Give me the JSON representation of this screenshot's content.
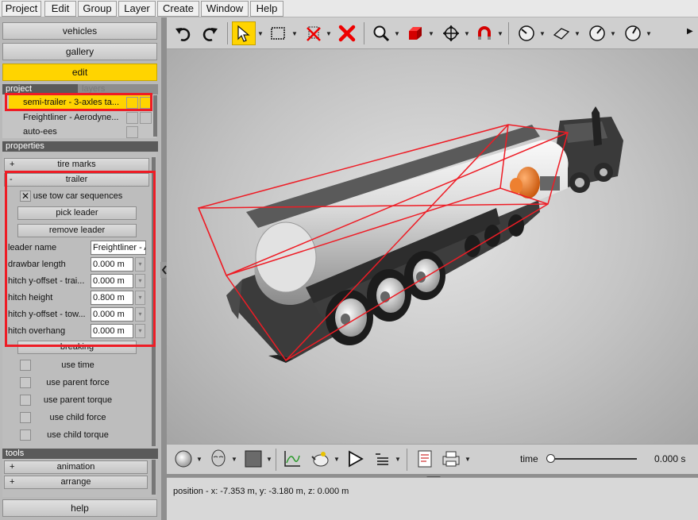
{
  "menubar": {
    "items": [
      {
        "label": "Project"
      },
      {
        "label": "Edit"
      },
      {
        "label": "Group"
      },
      {
        "label": "Layer"
      },
      {
        "label": "Create"
      },
      {
        "label": "Window"
      },
      {
        "label": "Help"
      }
    ]
  },
  "left_panel": {
    "top_buttons": {
      "vehicles": "vehicles",
      "gallery": "gallery",
      "edit": "edit"
    },
    "project_tabs": {
      "project": "project",
      "layers": "layers"
    },
    "project_items": [
      {
        "label": "semi-trailer - 3-axles ta...",
        "selected": true
      },
      {
        "label": "Freightliner - Aerodyne..."
      },
      {
        "label": "auto-ees"
      }
    ],
    "properties_header": "properties",
    "tire_marks": {
      "toggle": "+",
      "label": "tire marks"
    },
    "trailer": {
      "toggle": "-",
      "label": "trailer",
      "use_tow_car_sequences": {
        "label": "use tow car sequences",
        "checked": true,
        "mark": "✕"
      },
      "pick_leader": "pick leader",
      "remove_leader": "remove leader",
      "fields": [
        {
          "label": "leader name",
          "value": "Freightliner - A"
        },
        {
          "label": "drawbar length",
          "value": "0.000 m"
        },
        {
          "label": "hitch y-offset - trai...",
          "value": "0.000 m"
        },
        {
          "label": "hitch height",
          "value": "0.800 m"
        },
        {
          "label": "hitch y-offset - tow...",
          "value": "0.000 m"
        },
        {
          "label": "hitch overhang",
          "value": "0.000 m"
        }
      ]
    },
    "breaking": {
      "label": "breaking",
      "options": [
        {
          "label": "use time"
        },
        {
          "label": "use parent force"
        },
        {
          "label": "use parent torque"
        },
        {
          "label": "use child force"
        },
        {
          "label": "use child torque"
        }
      ]
    },
    "tools_header": "tools",
    "tools": [
      {
        "toggle": "+",
        "label": "animation"
      },
      {
        "toggle": "+",
        "label": "arrange"
      }
    ],
    "help": "help"
  },
  "top_toolbar": {
    "tools": [
      "undo-icon",
      "redo-icon",
      "select-arrow-icon",
      "rectangle-select-icon",
      "delete-icon",
      "close-red-icon",
      "zoom-icon",
      "red-cube-icon",
      "move-icon",
      "magnet-icon",
      "gauge-icon",
      "plane-icon",
      "dial-icon",
      "dial-icon-2"
    ]
  },
  "viewport": {
    "accent": "#ee1c25"
  },
  "bottom_toolbar": {
    "time_label": "time",
    "time_value": "0.000 s",
    "time_slider": 0
  },
  "status": {
    "position": "position - x: -7.353 m, y: -3.180 m, z: 0.000 m"
  }
}
